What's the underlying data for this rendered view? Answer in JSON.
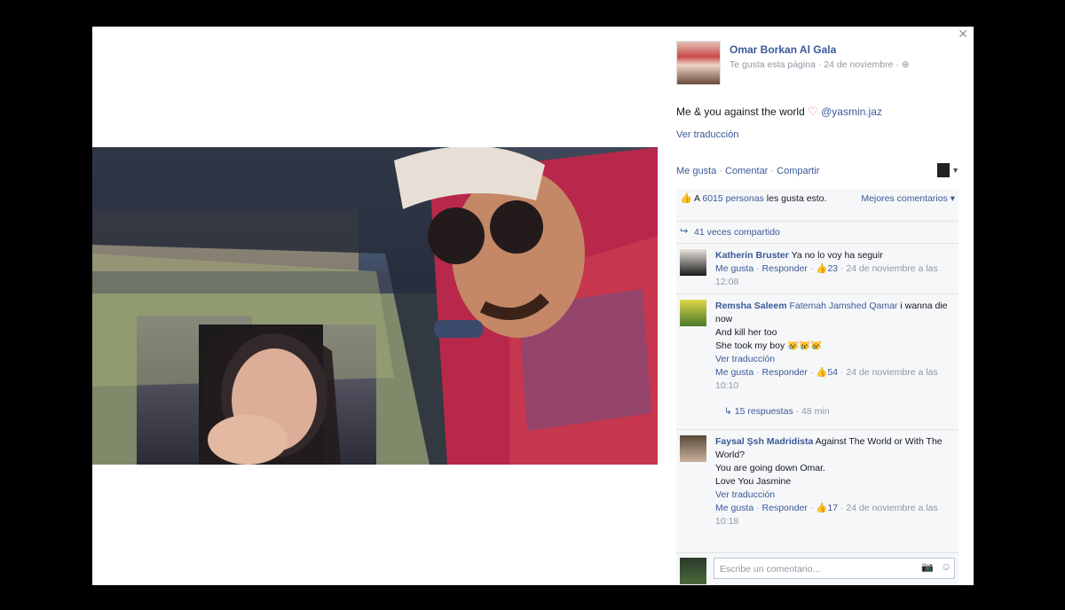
{
  "post": {
    "page_name": "Omar Borkan Al Gala",
    "liked_page": "Te gusta esta página",
    "date": "24 de noviembre",
    "text": "Me & you against the world",
    "mention": "@yasmin.jaz",
    "translate": "Ver traducción",
    "actions": [
      "Me gusta",
      "Comentar",
      "Compartir"
    ]
  },
  "feedback": {
    "likes_prefix": "A",
    "likes_count": "6015 personas",
    "likes_suffix": "les gusta esto.",
    "top_comments": "Mejores comentarios",
    "shares": "41 veces compartido"
  },
  "comments": [
    {
      "name": "Katherin Bruster",
      "text": "Ya no lo voy ha seguir",
      "like": "Me gusta",
      "reply": "Responder",
      "likes": "23",
      "date": "24 de noviembre a las 12:08"
    },
    {
      "name": "Remsha Saleem",
      "mention": "Fatemah Jamshed Qamar",
      "text_lines": [
        "i wanna die now",
        "And kill her too",
        "She took my boy 😿😿😿"
      ],
      "translate": "Ver traducción",
      "like": "Me gusta",
      "reply": "Responder",
      "likes": "54",
      "date": "24 de noviembre a las 10:10",
      "replies": "15 respuestas",
      "replies_time": "48 min"
    },
    {
      "name": "Faysal Şsh Madridista",
      "text_lines": [
        "Against The World or With The World?",
        "You are going down Omar.",
        "Love You Jasmine"
      ],
      "translate": "Ver traducción",
      "like": "Me gusta",
      "reply": "Responder",
      "likes": "17",
      "date": "24 de noviembre a las 10:18"
    }
  ],
  "composer": {
    "placeholder": "Escribe un comentario..."
  }
}
